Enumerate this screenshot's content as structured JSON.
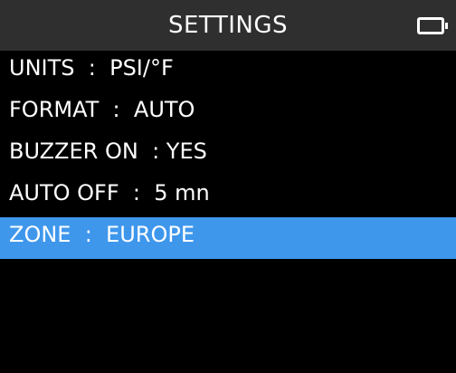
{
  "header": {
    "title": "SETTINGS",
    "battery_icon": "battery-icon"
  },
  "menu": {
    "selected_index": 4,
    "items": [
      {
        "label": "UNITS  :  PSI/°F"
      },
      {
        "label": "FORMAT  :  AUTO"
      },
      {
        "label": "BUZZER ON  : YES"
      },
      {
        "label": "AUTO OFF  :  5 mn"
      },
      {
        "label": "ZONE  :  EUROPE"
      }
    ]
  },
  "colors": {
    "background": "#000000",
    "title_bar": "#2f2f2f",
    "selection": "#3f97ec",
    "text": "#ffffff"
  }
}
